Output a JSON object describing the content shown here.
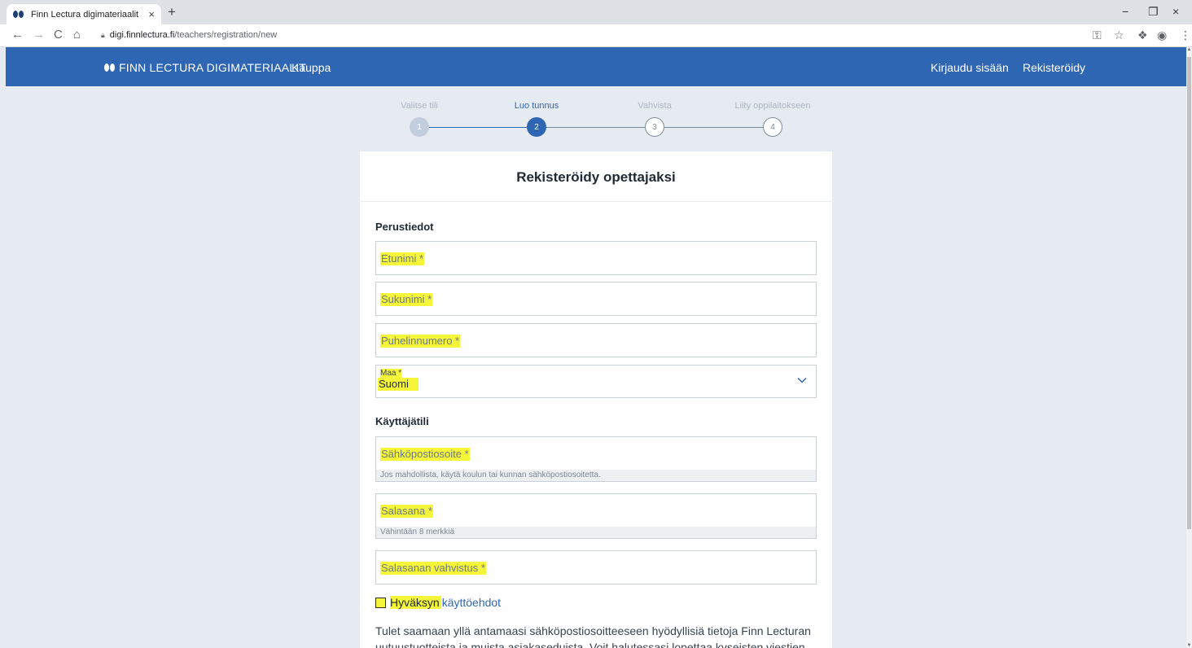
{
  "browser": {
    "tab_title": "Finn Lectura digimateriaalit",
    "tab_close": "×",
    "new_tab": "+",
    "url_domain": "digi.finnlectura.fi",
    "url_path": "/teachers/registration/new",
    "back_glyph": "←",
    "forward_glyph": "→",
    "reload_glyph": "C",
    "home_glyph": "⌂",
    "minimize_glyph": "−",
    "restore_glyph": "❐",
    "close_glyph": "×"
  },
  "nav": {
    "brand": "FINN LECTURA DIGIMATERIAALIT",
    "shop": "Kauppa",
    "login": "Kirjaudu sisään",
    "register": "Rekisteröidy"
  },
  "steps": [
    {
      "label": "Valitse tili",
      "number": "1",
      "state": "done"
    },
    {
      "label": "Luo tunnus",
      "number": "2",
      "state": "active"
    },
    {
      "label": "Vahvista",
      "number": "3",
      "state": "todo"
    },
    {
      "label": "Liity oppilaitokseen",
      "number": "4",
      "state": "todo"
    }
  ],
  "form": {
    "title": "Rekisteröidy opettajaksi",
    "basic_section": "Perustiedot",
    "first_name_placeholder": "Etunimi *",
    "last_name_placeholder": "Sukunimi *",
    "phone_placeholder": "Puhelinnumero *",
    "country_label": "Maa *",
    "country_value": "Suomi",
    "account_section": "Käyttäjätili",
    "email_placeholder": "Sähköpostiosoite *",
    "email_hint": "Jos mahdollista, käytä koulun tai kunnan sähköpostiosoitetta.",
    "password_placeholder": "Salasana *",
    "password_hint": "Vähintään 8 merkkiä",
    "password_confirm_placeholder": "Salasanan vahvistus *",
    "accept_text": "Hyväksyn",
    "terms_link": "käyttöehdot",
    "info_text": "Tulet saamaan yllä antamaasi sähköpostiosoitteeseen hyödyllisiä tietoja Finn Lecturan uutuustuotteista ja muista asiakaseduista. Voit halutessasi lopettaa kyseisten viestien"
  },
  "colors": {
    "brand_blue": "#2f66b3",
    "highlight": "#f5f53a",
    "page_bg": "#e6ebf2"
  }
}
